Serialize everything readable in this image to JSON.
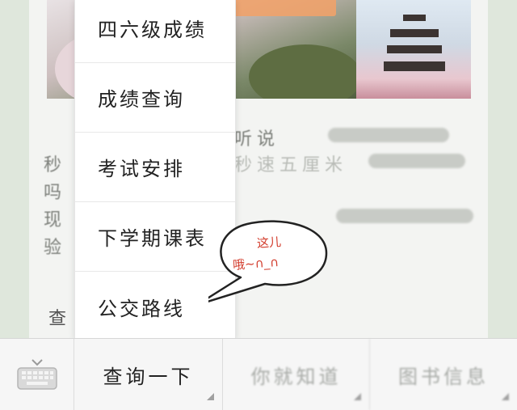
{
  "menu": {
    "items": [
      {
        "label": "四六级成绩"
      },
      {
        "label": "成绩查询"
      },
      {
        "label": "考试安排"
      },
      {
        "label": "下学期课表"
      },
      {
        "label": "公交路线"
      }
    ]
  },
  "annotation": {
    "line1": "这儿",
    "line2": "哦~∩_∩"
  },
  "bottom_bar": {
    "keyboard_icon": "keyboard-icon",
    "tabs": [
      {
        "label": "查询一下"
      },
      {
        "label": "你就知道"
      },
      {
        "label": "图书信息"
      }
    ]
  },
  "article": {
    "visible_fragments": [
      "“",
      "听说",
      "秒",
      "秒速五厘米",
      "吗",
      "现",
      "验",
      "查"
    ]
  },
  "colors": {
    "annotation_text": "#d23a2a",
    "menu_bg": "#ffffff",
    "bar_bg": "#f6f6f6"
  }
}
